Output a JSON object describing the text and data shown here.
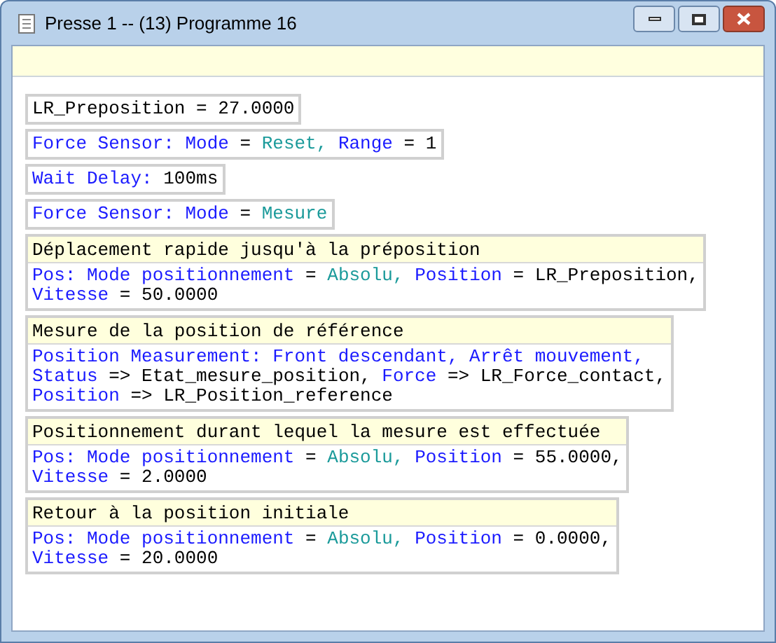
{
  "window": {
    "title": "Presse 1 -- (13) Programme 16"
  },
  "blocks": [
    {
      "lines": [
        [
          {
            "kind": "plain",
            "text": "LR_Preposition = 27.0000"
          }
        ]
      ]
    },
    {
      "lines": [
        [
          {
            "kind": "keyword",
            "text": "Force Sensor: Mode"
          },
          {
            "kind": "plain",
            "text": " = "
          },
          {
            "kind": "value",
            "text": "Reset, "
          },
          {
            "kind": "keyword",
            "text": "Range"
          },
          {
            "kind": "plain",
            "text": " = 1"
          }
        ]
      ]
    },
    {
      "lines": [
        [
          {
            "kind": "keyword",
            "text": "Wait Delay:"
          },
          {
            "kind": "plain",
            "text": " 100ms"
          }
        ]
      ]
    },
    {
      "lines": [
        [
          {
            "kind": "keyword",
            "text": "Force Sensor: Mode"
          },
          {
            "kind": "plain",
            "text": " = "
          },
          {
            "kind": "value",
            "text": "Mesure"
          }
        ]
      ]
    },
    {
      "header": "Déplacement rapide jusqu'à la préposition",
      "lines": [
        [
          {
            "kind": "keyword",
            "text": "Pos: Mode positionnement"
          },
          {
            "kind": "plain",
            "text": " = "
          },
          {
            "kind": "value",
            "text": "Absolu, "
          },
          {
            "kind": "keyword",
            "text": "Position"
          },
          {
            "kind": "plain",
            "text": " = LR_Preposition,"
          }
        ],
        [
          {
            "kind": "keyword",
            "text": "Vitesse"
          },
          {
            "kind": "plain",
            "text": " = 50.0000"
          }
        ]
      ]
    },
    {
      "header": "Mesure de la position de référence",
      "lines": [
        [
          {
            "kind": "keyword",
            "text": "Position Measurement: Front descendant, Arrêt mouvement,"
          }
        ],
        [
          {
            "kind": "keyword",
            "text": "Status"
          },
          {
            "kind": "plain",
            "text": " => Etat_mesure_position, "
          },
          {
            "kind": "keyword",
            "text": "Force"
          },
          {
            "kind": "plain",
            "text": " => LR_Force_contact,"
          }
        ],
        [
          {
            "kind": "keyword",
            "text": "Position"
          },
          {
            "kind": "plain",
            "text": " => LR_Position_reference"
          }
        ]
      ]
    },
    {
      "header": "Positionnement durant lequel la mesure est effectuée",
      "lines": [
        [
          {
            "kind": "keyword",
            "text": "Pos: Mode positionnement"
          },
          {
            "kind": "plain",
            "text": " = "
          },
          {
            "kind": "value",
            "text": "Absolu, "
          },
          {
            "kind": "keyword",
            "text": "Position"
          },
          {
            "kind": "plain",
            "text": " = 55.0000,"
          }
        ],
        [
          {
            "kind": "keyword",
            "text": "Vitesse"
          },
          {
            "kind": "plain",
            "text": " = 2.0000"
          }
        ]
      ]
    },
    {
      "header": "Retour à la position initiale",
      "lines": [
        [
          {
            "kind": "keyword",
            "text": "Pos: Mode positionnement"
          },
          {
            "kind": "plain",
            "text": " = "
          },
          {
            "kind": "value",
            "text": "Absolu, "
          },
          {
            "kind": "keyword",
            "text": "Position"
          },
          {
            "kind": "plain",
            "text": " = 0.0000,"
          }
        ],
        [
          {
            "kind": "keyword",
            "text": "Vitesse"
          },
          {
            "kind": "plain",
            "text": " = 20.0000"
          }
        ]
      ]
    }
  ]
}
